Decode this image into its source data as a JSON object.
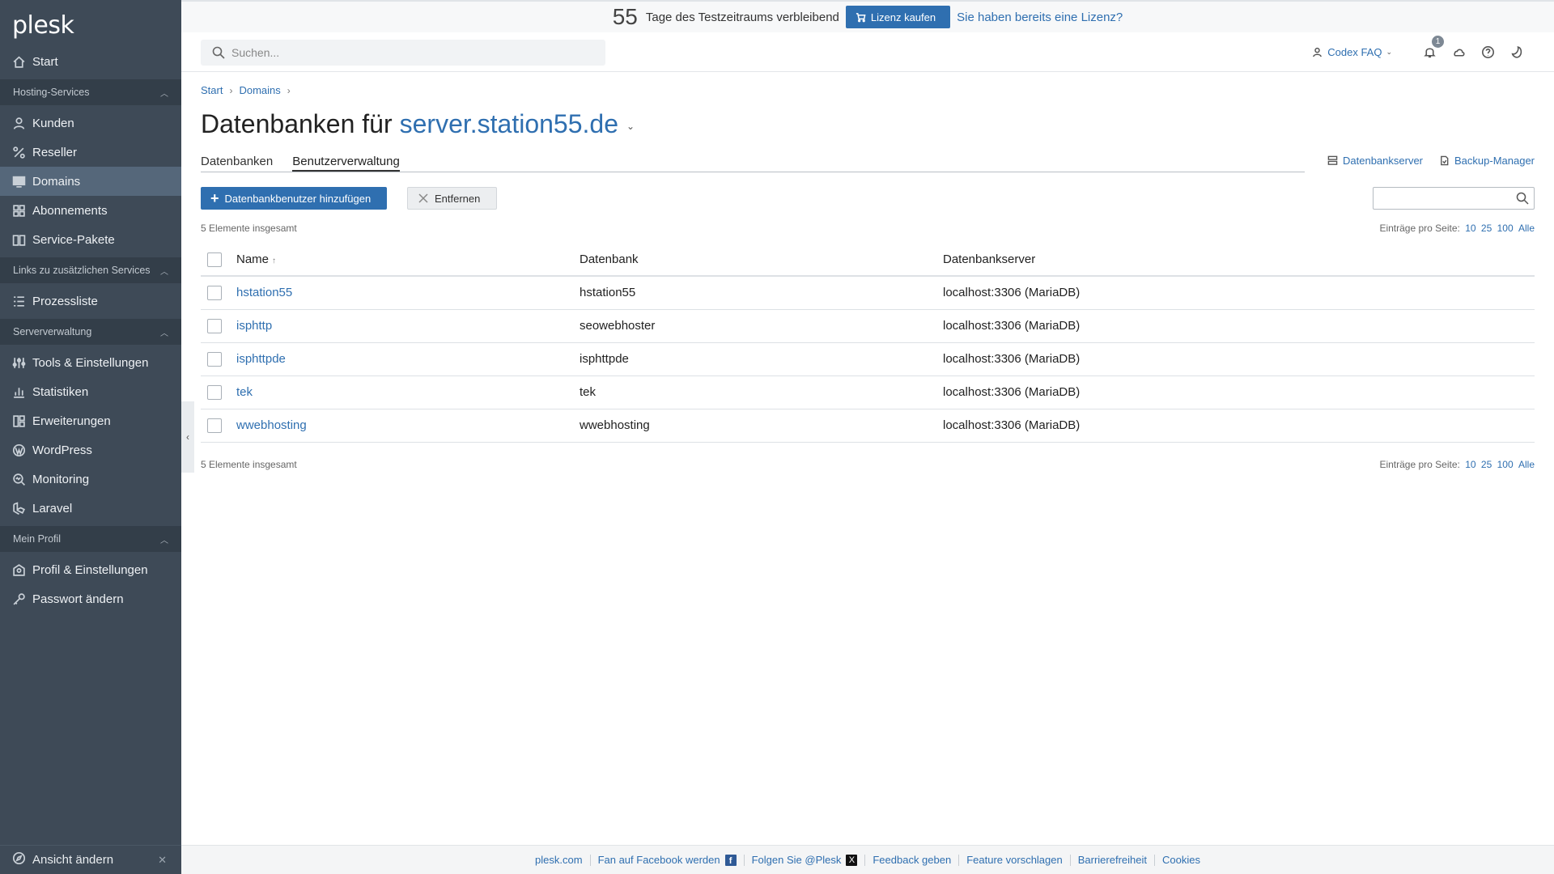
{
  "sidebar": {
    "logo": "plesk",
    "start": "Start",
    "sections": {
      "hosting": "Hosting-Services",
      "links": "Links zu zusätzlichen Services",
      "server": "Serververwaltung",
      "profile": "Mein Profil"
    },
    "items": {
      "kunden": "Kunden",
      "reseller": "Reseller",
      "domains": "Domains",
      "abonnements": "Abonnements",
      "pakete": "Service-Pakete",
      "prozessliste": "Prozessliste",
      "tools": "Tools & Einstellungen",
      "statistiken": "Statistiken",
      "erweiterungen": "Erweiterungen",
      "wordpress": "WordPress",
      "monitoring": "Monitoring",
      "laravel": "Laravel",
      "profil": "Profil & Einstellungen",
      "passwort": "Passwort ändern"
    },
    "bottom": "Ansicht ändern"
  },
  "banner": {
    "days": "55",
    "text": "Tage des Testzeitraums verbleibend",
    "buy": "Lizenz kaufen",
    "have_license": "Sie haben bereits eine Lizenz?"
  },
  "header": {
    "search_placeholder": "Suchen...",
    "user": "Codex FAQ",
    "notification_count": "1"
  },
  "breadcrumb": [
    "Start",
    "Domains"
  ],
  "page": {
    "title_prefix": "Datenbanken für",
    "title_domain": "server.station55.de"
  },
  "tabs": [
    "Datenbanken",
    "Benutzerverwaltung"
  ],
  "tab_links": [
    "Datenbankserver",
    "Backup-Manager"
  ],
  "toolbar": {
    "add": "Datenbankbenutzer hinzufügen",
    "remove": "Entfernen"
  },
  "list": {
    "total": "5 Elemente insgesamt",
    "per_page_label": "Einträge pro Seite:",
    "per_page": [
      "10",
      "25",
      "100",
      "Alle"
    ],
    "columns": [
      "Name",
      "Datenbank",
      "Datenbankserver"
    ],
    "rows": [
      {
        "name": "hstation55",
        "db": "hstation55",
        "server": "localhost:3306 (MariaDB)"
      },
      {
        "name": "isphttp",
        "db": "seowebhoster",
        "server": "localhost:3306 (MariaDB)"
      },
      {
        "name": "isphttpde",
        "db": "isphttpde",
        "server": "localhost:3306 (MariaDB)"
      },
      {
        "name": "tek",
        "db": "tek",
        "server": "localhost:3306 (MariaDB)"
      },
      {
        "name": "wwebhosting",
        "db": "wwebhosting",
        "server": "localhost:3306 (MariaDB)"
      }
    ]
  },
  "footer": {
    "links": [
      "plesk.com",
      "Fan auf Facebook werden",
      "Folgen Sie @Plesk",
      "Feedback geben",
      "Feature vorschlagen",
      "Barrierefreiheit",
      "Cookies"
    ]
  },
  "colors": {
    "sidebar": "#3e4a57",
    "sidebar_section": "#333e49",
    "accent": "#2f6fb0"
  }
}
